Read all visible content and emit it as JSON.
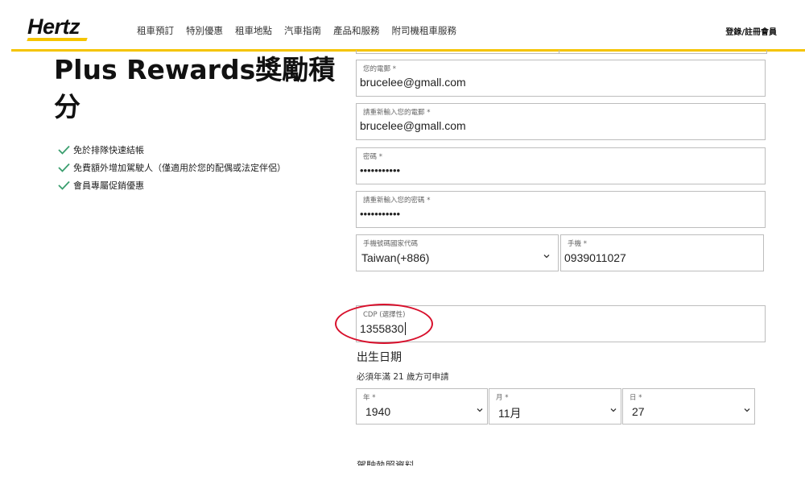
{
  "header": {
    "logo": "Hertz",
    "nav": [
      "租車預訂",
      "特別優惠",
      "租車地點",
      "汽車指南",
      "產品和服務",
      "附司機租車服務"
    ],
    "login": "登錄/註冊會員",
    "accent_color": "#f5c400"
  },
  "left": {
    "title": "Plus Rewards獎勵積分",
    "benefits": [
      "免於排隊快速結帳",
      "免費額外增加駕駛人（僅適用於您的配偶或法定伴侶）",
      "會員專屬促銷優惠"
    ],
    "check_icon": "check-icon",
    "check_color": "#3a9e6e"
  },
  "form": {
    "email": {
      "label": "您的電郵 *",
      "value": "brucelee@gmall.com"
    },
    "email_confirm": {
      "label": "請重新輸入您的電郵 *",
      "value": "brucelee@gmall.com"
    },
    "password": {
      "label": "密碼 *",
      "value": "•••••••••••"
    },
    "password_confirm": {
      "label": "請重新輸入您的密碼 *",
      "value": "•••••••••••"
    },
    "country_code": {
      "label": "手機號碼國家代碼",
      "value": "Taiwan(+886)"
    },
    "mobile": {
      "label": "手機 *",
      "value": "0939011027"
    },
    "cdp": {
      "label": "CDP (選擇性)",
      "value": "1355830"
    },
    "dob": {
      "title": "出生日期",
      "note": "必須年滿 21 歲方可申請",
      "year": {
        "label": "年 *",
        "value": "1940"
      },
      "month": {
        "label": "月 *",
        "value": "11月"
      },
      "day": {
        "label": "日 *",
        "value": "27"
      }
    },
    "next_section": "駕駛執照資料",
    "highlight_color": "#d8102c"
  }
}
